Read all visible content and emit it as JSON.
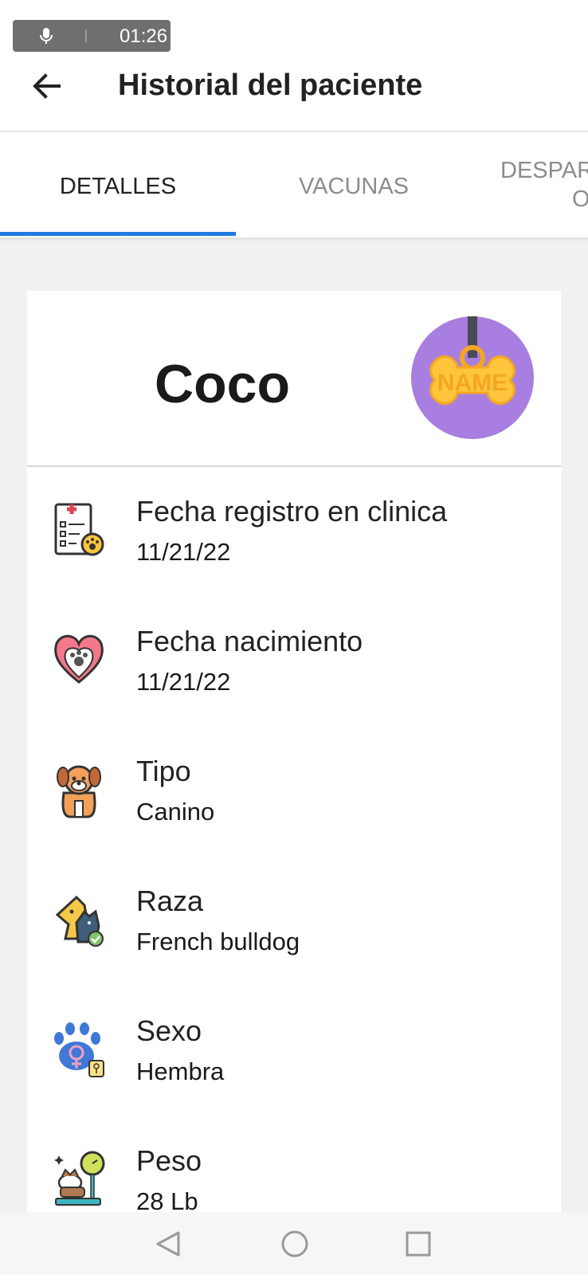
{
  "status_bar": {
    "time": "01:26",
    "mic_icon": "mic-icon"
  },
  "header": {
    "title": "Historial del paciente",
    "back_icon": "arrow-left-icon"
  },
  "tabs": [
    {
      "label": "DETALLES",
      "selected": true
    },
    {
      "label": "VACUNAS",
      "selected": false
    },
    {
      "label_line1": "DESPAR",
      "label_line2": "O",
      "selected": false
    }
  ],
  "colors": {
    "accent": "#1e7be0",
    "avatar_bg": "#a87ee0",
    "tag_yellow": "#ffc53d"
  },
  "patient": {
    "name": "Coco",
    "avatar_icon": "bone-name-tag-icon",
    "avatar_text": "NAME"
  },
  "details": [
    {
      "icon": "clinic-record-icon",
      "label": "Fecha registro en clinica",
      "value": "11/21/22"
    },
    {
      "icon": "heart-paw-icon",
      "label": "Fecha nacimiento",
      "value": "11/21/22"
    },
    {
      "icon": "dog-icon",
      "label": "Tipo",
      "value": "Canino"
    },
    {
      "icon": "dog-cat-breed-icon",
      "label": "Raza",
      "value": "French bulldog"
    },
    {
      "icon": "paw-female-icon",
      "label": "Sexo",
      "value": "Hembra"
    },
    {
      "icon": "dog-scale-icon",
      "label": "Peso",
      "value": "28 Lb"
    }
  ],
  "navbar": {
    "back": "triangle-back-icon",
    "home": "circle-home-icon",
    "recent": "square-recent-icon"
  }
}
